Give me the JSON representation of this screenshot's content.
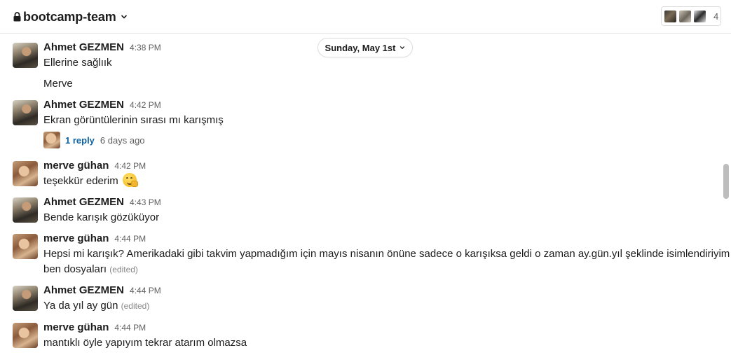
{
  "header": {
    "channel_name": "bootcamp-team",
    "member_count": "4",
    "lock_icon": "lock-icon",
    "chevron_icon": "chevron-down-icon"
  },
  "date_divider": {
    "label": "Sunday, May 1st"
  },
  "messages": [
    {
      "author": "Ahmet GEZMEN",
      "time": "4:38 PM",
      "lines": [
        "Ellerine sağlıık",
        "Merve"
      ]
    },
    {
      "author": "Ahmet GEZMEN",
      "time": "4:42 PM",
      "text": "Ekran görüntülerinin sırası mı karışmış",
      "thread": {
        "reply_count": "1 reply",
        "last_reply": "6 days ago"
      }
    },
    {
      "author": "merve gühan",
      "time": "4:42 PM",
      "text": "teşekkür ederim",
      "emoji": "hugging-face-emoji"
    },
    {
      "author": "Ahmet GEZMEN",
      "time": "4:43 PM",
      "text": "Bende karışık gözüküyor"
    },
    {
      "author": "merve gühan",
      "time": "4:44 PM",
      "text_line1": "Hepsi mi karışık? Amerikadaki gibi takvim yapmadığım için mayıs nisanın önüne sadece o karışıksa geldi o zaman ay.gün.yıl şeklinde isimlendiriyim",
      "text_line2": "ben dosyaları",
      "edited": "(edited)"
    },
    {
      "author": "Ahmet GEZMEN",
      "time": "4:44 PM",
      "text": "Ya da yıl ay gün",
      "edited": "(edited)"
    },
    {
      "author": "merve gühan",
      "time": "4:44 PM",
      "text": "mantıklı öyle yapıyım tekrar atarım olmazsa"
    }
  ]
}
